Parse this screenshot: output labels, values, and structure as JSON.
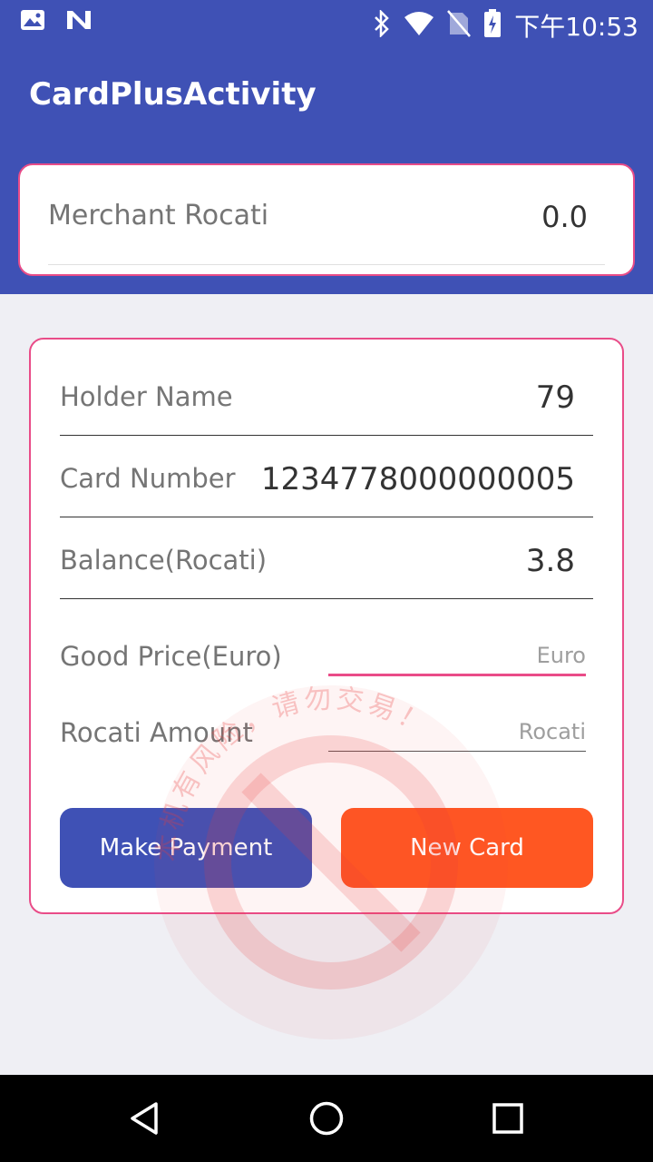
{
  "status_bar": {
    "time": "下午10:53",
    "icons": [
      "image-icon",
      "n-icon",
      "bluetooth-icon",
      "wifi-icon",
      "no-sim-icon",
      "battery-icon"
    ]
  },
  "app_bar": {
    "title": "CardPlusActivity",
    "color": "#3F51B5"
  },
  "merchant": {
    "label": "Merchant Rocati",
    "value": "0.0"
  },
  "card": {
    "holder_name_label": "Holder Name",
    "holder_name_value": "79",
    "card_number_label": "Card Number",
    "card_number_value": "1234778000000005",
    "balance_label": "Balance(Rocati)",
    "balance_value": "3.8"
  },
  "inputs": {
    "good_price_label": "Good Price(Euro)",
    "good_price_placeholder": "Euro",
    "good_price_value": "",
    "rocati_amount_label": "Rocati Amount",
    "rocati_amount_placeholder": "Rocati",
    "rocati_amount_value": ""
  },
  "buttons": {
    "make_payment": "Make Payment",
    "new_card": "New Card"
  },
  "watermark": {
    "text": "本机有风险，请勿交易！"
  },
  "colors": {
    "primary": "#3F51B5",
    "accent": "#E94C88",
    "button_orange": "#FF5722",
    "background": "#EFEFF4"
  },
  "nav": {
    "icons": [
      "back-icon",
      "home-icon",
      "recents-icon"
    ]
  }
}
